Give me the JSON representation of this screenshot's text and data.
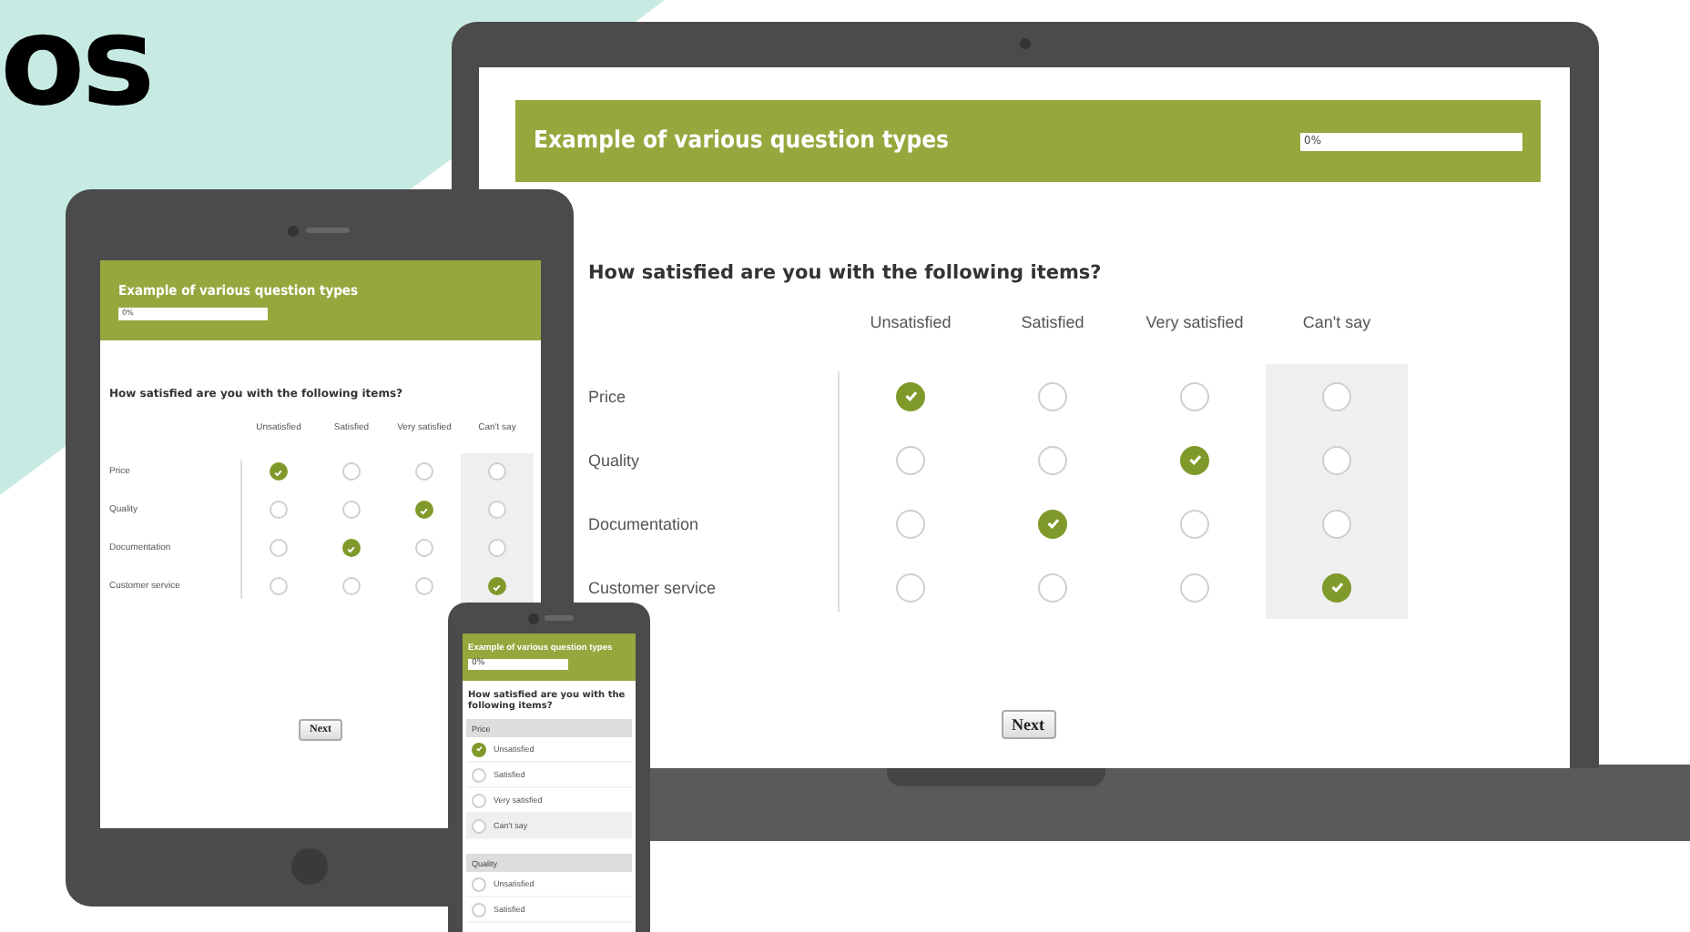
{
  "headline": "os",
  "laptop": {
    "title": "Example of various question types",
    "progress": {
      "label": "0%",
      "level": 0
    },
    "question": "How satisfied are you with the following items?",
    "columns": [
      {
        "label": "Unsatisfied",
        "kind": "answer"
      },
      {
        "label": "Satisfied",
        "kind": "answer"
      },
      {
        "label": "Very satisfied",
        "kind": "answer"
      },
      {
        "label": "Can't say",
        "kind": "no-opinion"
      }
    ],
    "rows": [
      {
        "label": "Price",
        "choices": [
          {
            "selected": true
          },
          {
            "selected": false
          },
          {
            "selected": false
          },
          {
            "selected": false
          }
        ]
      },
      {
        "label": "Quality",
        "choices": [
          {
            "selected": false
          },
          {
            "selected": false
          },
          {
            "selected": true
          },
          {
            "selected": false
          }
        ]
      },
      {
        "label": "Documentation",
        "choices": [
          {
            "selected": false
          },
          {
            "selected": true
          },
          {
            "selected": false
          },
          {
            "selected": false
          }
        ]
      },
      {
        "label": "Customer service",
        "choices": [
          {
            "selected": false
          },
          {
            "selected": false
          },
          {
            "selected": false
          },
          {
            "selected": true
          }
        ]
      }
    ],
    "next_button": "Next"
  },
  "tablet": {
    "title": "Example of various question types",
    "progress": {
      "label": "0%",
      "level": 0
    },
    "question": "How satisfied are you with the following items?",
    "columns": [
      {
        "label": "Unsatisfied",
        "kind": "answer"
      },
      {
        "label": "Satisfied",
        "kind": "answer"
      },
      {
        "label": "Very satisfied",
        "kind": "answer"
      },
      {
        "label": "Can't say",
        "kind": "no-opinion"
      }
    ],
    "rows": [
      {
        "label": "Price",
        "choices": [
          {
            "selected": true
          },
          {
            "selected": false
          },
          {
            "selected": false
          },
          {
            "selected": false
          }
        ]
      },
      {
        "label": "Quality",
        "choices": [
          {
            "selected": false
          },
          {
            "selected": false
          },
          {
            "selected": true
          },
          {
            "selected": false
          }
        ]
      },
      {
        "label": "Documentation",
        "choices": [
          {
            "selected": false
          },
          {
            "selected": true
          },
          {
            "selected": false
          },
          {
            "selected": false
          }
        ]
      },
      {
        "label": "Customer service",
        "choices": [
          {
            "selected": false
          },
          {
            "selected": false
          },
          {
            "selected": false
          },
          {
            "selected": true
          }
        ]
      }
    ],
    "next_button": "Next"
  },
  "phone": {
    "title": "Example of various question types",
    "progress": {
      "label": "0%",
      "level": 0
    },
    "question": "How satisfied are you with the following items?",
    "groups": [
      {
        "label": "Price",
        "options": [
          {
            "label": "Unsatisfied",
            "kind": "answer",
            "selected": true
          },
          {
            "label": "Satisfied",
            "kind": "answer",
            "selected": false
          },
          {
            "label": "Very satisfied",
            "kind": "answer",
            "selected": false
          },
          {
            "label": "Can't say",
            "kind": "no-opinion",
            "selected": false
          }
        ]
      },
      {
        "label": "Quality",
        "options": [
          {
            "label": "Unsatisfied",
            "kind": "answer",
            "selected": false
          },
          {
            "label": "Satisfied",
            "kind": "answer",
            "selected": false
          }
        ]
      }
    ]
  }
}
